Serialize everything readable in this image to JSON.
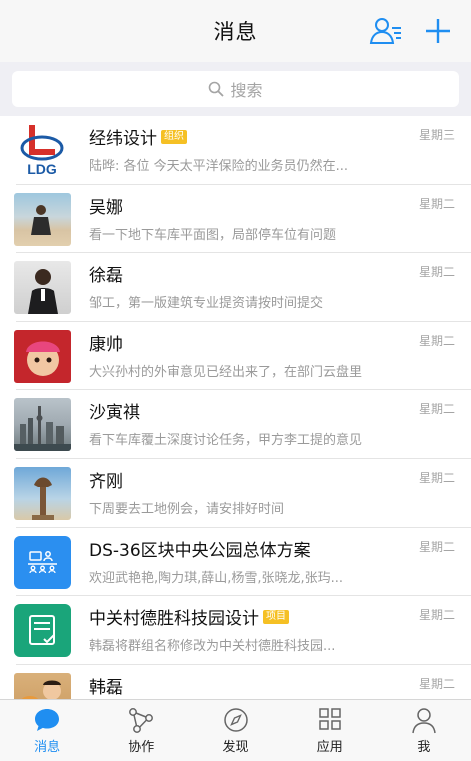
{
  "header": {
    "title": "消息"
  },
  "search": {
    "placeholder": "搜索"
  },
  "conversations": [
    {
      "name": "经纬设计",
      "tag": "组织",
      "time": "星期三",
      "preview": "陆晔: 各位 今天太平洋保险的业务员仍然在...",
      "avatar": "ldg-logo",
      "logo_text": "LDG"
    },
    {
      "name": "吴娜",
      "tag": "",
      "time": "星期二",
      "preview": "看一下地下车库平面图，局部停车位有问题",
      "avatar": "photo-beach"
    },
    {
      "name": "徐磊",
      "tag": "",
      "time": "星期二",
      "preview": "邹工，第一版建筑专业提资请按时间提交",
      "avatar": "photo-man-suit"
    },
    {
      "name": "康帅",
      "tag": "",
      "time": "星期二",
      "preview": "大兴孙村的外审意见已经出来了，在部门云盘里",
      "avatar": "photo-baby"
    },
    {
      "name": "沙寅祺",
      "tag": "",
      "time": "星期二",
      "preview": "看下车库覆土深度讨论任务，甲方李工提的意见",
      "avatar": "photo-city"
    },
    {
      "name": "齐刚",
      "tag": "",
      "time": "星期二",
      "preview": "下周要去工地例会，请安排好时间",
      "avatar": "photo-tower"
    },
    {
      "name": "DS-36区块中央公园总体方案",
      "tag": "",
      "time": "星期二",
      "preview": "欢迎武艳艳,陶力琪,薛山,杨雪,张晓龙,张玙...",
      "avatar": "group-icon-blue"
    },
    {
      "name": "中关村德胜科技园设计",
      "tag": "项目",
      "time": "星期二",
      "preview": "韩磊将群组名称修改为中关村德胜科技园...",
      "avatar": "project-icon-green"
    },
    {
      "name": "韩磊",
      "tag": "",
      "time": "星期二",
      "preview": "",
      "avatar": "photo-child-cat"
    }
  ],
  "tabs": [
    {
      "label": "消息",
      "icon": "chat-bubble-icon",
      "active": true
    },
    {
      "label": "协作",
      "icon": "network-icon",
      "active": false
    },
    {
      "label": "发现",
      "icon": "compass-icon",
      "active": false
    },
    {
      "label": "应用",
      "icon": "grid-icon",
      "active": false
    },
    {
      "label": "我",
      "icon": "person-icon",
      "active": false
    }
  ],
  "colors": {
    "accent": "#1f8ef1",
    "tag": "#f5c024",
    "group_blue": "#2b8ff0",
    "project_green": "#1aa57a"
  }
}
